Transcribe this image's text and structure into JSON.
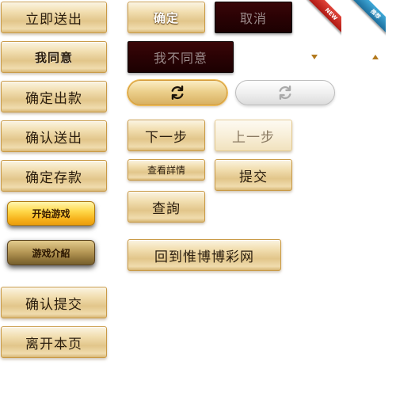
{
  "left_column": {
    "submit_now": "立即送出",
    "i_agree": "我同意",
    "confirm_withdraw": "确定出款",
    "confirm_send": "确认送出",
    "confirm_deposit": "确定存款",
    "start_game": "开始游戏",
    "game_intro": "游戏介紹",
    "confirm_submit": "确认提交",
    "leave_page": "离开本页"
  },
  "right_column": {
    "confirm": "确定",
    "cancel": "取消",
    "disagree": "我不同意",
    "next_step": "下一步",
    "prev_step": "上一步",
    "view_details": "查看詳情",
    "submit": "提交",
    "query": "查詢",
    "back_home": "回到惟博博彩网"
  },
  "ribbons": {
    "new": "NEW",
    "recommend": "推荐"
  },
  "icons": {
    "refresh_active": "refresh-icon",
    "refresh_disabled": "refresh-icon",
    "dropdown": "caret-down-icon",
    "collapse": "caret-up-icon"
  },
  "colors": {
    "gold_border": "#c99a46",
    "dark_button": "#2a0204",
    "ribbon_red": "#b01812",
    "ribbon_blue": "#1c6e9c",
    "arrow": "#b37a1e"
  }
}
